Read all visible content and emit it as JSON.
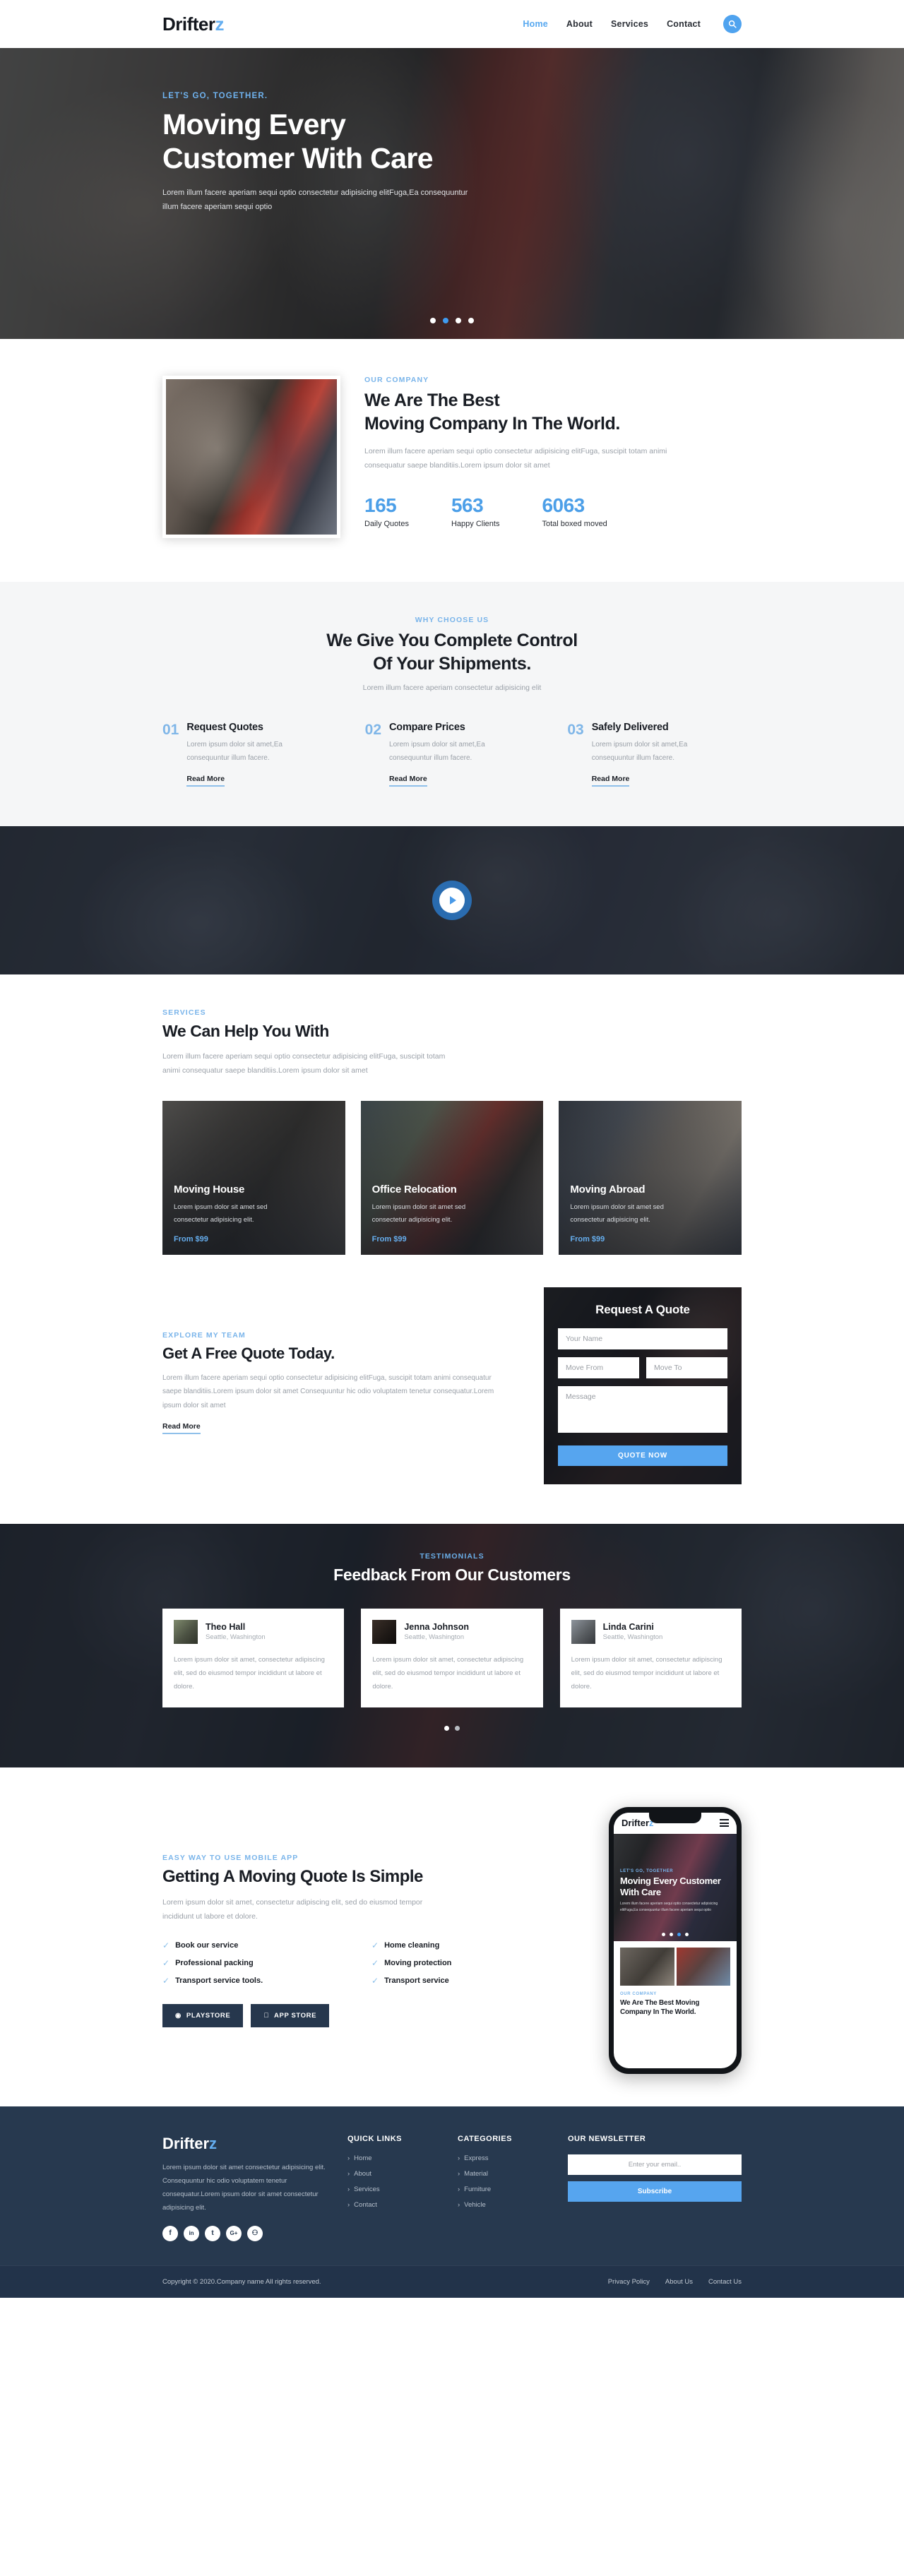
{
  "header": {
    "logo_main": "Drifter",
    "logo_accent": "z",
    "nav": [
      {
        "label": "Home",
        "active": true
      },
      {
        "label": "About",
        "active": false
      },
      {
        "label": "Services",
        "active": false
      },
      {
        "label": "Contact",
        "active": false
      }
    ],
    "search_icon": "search-icon"
  },
  "hero": {
    "kicker": "LET'S GO, TOGETHER.",
    "title_line1": "Moving Every",
    "title_line2": "Customer With Care",
    "paragraph": "Lorem illum facere aperiam sequi optio consectetur adipisicing elitFuga,Ea consequuntur illum facere aperiam sequi optio",
    "slider_dots": 4,
    "active_dot": 1
  },
  "about": {
    "kicker": "OUR COMPANY",
    "title_line1": "We Are The Best",
    "title_line2": "Moving Company In The World.",
    "paragraph": "Lorem illum facere aperiam sequi optio consectetur adipisicing elitFuga, suscipit totam animi consequatur saepe blanditiis.Lorem ipsum dolor sit amet",
    "stats": [
      {
        "number": "165",
        "label": "Daily Quotes"
      },
      {
        "number": "563",
        "label": "Happy Clients"
      },
      {
        "number": "6063",
        "label": "Total boxed moved"
      }
    ]
  },
  "why": {
    "kicker": "WHY CHOOSE US",
    "title_line1": "We Give You Complete Control",
    "title_line2": "Of Your Shipments.",
    "subtitle": "Lorem illum facere aperiam consectetur adipisicing elit",
    "items": [
      {
        "num": "01",
        "title": "Request Quotes",
        "text": "Lorem ipsum dolor sit amet,Ea consequuntur illum facere.",
        "link": "Read More"
      },
      {
        "num": "02",
        "title": "Compare Prices",
        "text": "Lorem ipsum dolor sit amet,Ea consequuntur illum facere.",
        "link": "Read More"
      },
      {
        "num": "03",
        "title": "Safely Delivered",
        "text": "Lorem ipsum dolor sit amet,Ea consequuntur illum facere.",
        "link": "Read More"
      }
    ]
  },
  "video": {
    "play_icon": "play-icon"
  },
  "services": {
    "kicker": "SERVICES",
    "title": "We Can Help You With",
    "paragraph": "Lorem illum facere aperiam sequi optio consectetur adipisicing elitFuga, suscipit totam animi consequatur saepe blanditiis.Lorem ipsum dolor sit amet",
    "cards": [
      {
        "title": "Moving House",
        "text": "Lorem ipsum dolor sit amet sed consectetur adipisicing elit.",
        "price": "From $99"
      },
      {
        "title": "Office Relocation",
        "text": "Lorem ipsum dolor sit amet sed consectetur adipisicing elit.",
        "price": "From $99"
      },
      {
        "title": "Moving Abroad",
        "text": "Lorem ipsum dolor sit amet sed consectetur adipisicing elit.",
        "price": "From $99"
      }
    ]
  },
  "quote": {
    "kicker": "EXPLORE MY TEAM",
    "title": "Get A Free Quote Today.",
    "paragraph": "Lorem illum facere aperiam sequi optio consectetur adipisicing elitFuga, suscipit totam animi consequatur saepe blanditiis.Lorem ipsum dolor sit amet Consequuntur hic odio voluptatem tenetur consequatur.Lorem ipsum dolor sit amet",
    "link": "Read More",
    "form": {
      "title": "Request A Quote",
      "name_placeholder": "Your Name",
      "from_placeholder": "Move From",
      "to_placeholder": "Move To",
      "message_placeholder": "Message",
      "submit_label": "QUOTE NOW"
    }
  },
  "testimonials": {
    "kicker": "TESTIMONIALS",
    "title": "Feedback From Our Customers",
    "cards": [
      {
        "name": "Theo Hall",
        "location": "Seattle, Washington",
        "text": "Lorem ipsum dolor sit amet, consectetur adipiscing elit, sed do eiusmod tempor incididunt ut labore et dolore."
      },
      {
        "name": "Jenna Johnson",
        "location": "Seattle, Washington",
        "text": "Lorem ipsum dolor sit amet, consectetur adipiscing elit, sed do eiusmod tempor incididunt ut labore et dolore."
      },
      {
        "name": "Linda Carini",
        "location": "Seattle, Washington",
        "text": "Lorem ipsum dolor sit amet, consectetur adipiscing elit, sed do eiusmod tempor incididunt ut labore et dolore."
      }
    ],
    "dots": 2
  },
  "app": {
    "kicker": "EASY WAY TO USE MOBILE APP",
    "title": "Getting A Moving Quote Is Simple",
    "paragraph": "Lorem ipsum dolor sit amet, consectetur adipiscing elit, sed do eiusmod tempor incididunt ut labore et dolore.",
    "features": [
      "Book our service",
      "Home cleaning",
      "Professional packing",
      "Moving protection",
      "Transport service tools.",
      "Transport service"
    ],
    "buttons": [
      {
        "label": "PLAYSTORE",
        "icon": "play-store-icon"
      },
      {
        "label": "APP STORE",
        "icon": "apple-icon"
      }
    ],
    "phone": {
      "logo_main": "Drifter",
      "logo_accent": "z",
      "menu_icon": "hamburger-icon",
      "hero_kicker": "LET'S GO, TOGETHER",
      "hero_title": "Moving Every Customer With Care",
      "hero_paragraph": "Lorem illum facere aperiam sequi optio consectetur adipisicing elitFuga,Ea consequuntur illum facere aperiam sequi optio",
      "about_kicker": "OUR COMPANY",
      "about_title": "We Are The Best Moving Company In The World."
    }
  },
  "footer": {
    "logo_main": "Drifter",
    "logo_accent": "z",
    "description": "Lorem ipsum dolor sit amet consectetur adipisicing elit. Consequuntur hic odio voluptatem tenetur consequatur.Lorem ipsum dolor sit amet consectetur adipisicing elit.",
    "socials": [
      {
        "name": "facebook-icon",
        "glyph": "f"
      },
      {
        "name": "linkedin-icon",
        "glyph": "in"
      },
      {
        "name": "twitter-icon",
        "glyph": "t"
      },
      {
        "name": "google-plus-icon",
        "glyph": "G+"
      },
      {
        "name": "github-icon",
        "glyph": "⚇"
      }
    ],
    "quick_links_title": "QUICK LINKS",
    "quick_links": [
      "Home",
      "About",
      "Services",
      "Contact"
    ],
    "categories_title": "CATEGORIES",
    "categories": [
      "Express",
      "Material",
      "Furniture",
      "Vehicle"
    ],
    "newsletter_title": "OUR NEWSLETTER",
    "newsletter_placeholder": "Enter your email..",
    "newsletter_button": "Subscribe",
    "copyright": "Copyright © 2020.Company name All rights reserved.",
    "bottom_links": [
      "Privacy Policy",
      "About Us",
      "Contact Us"
    ]
  },
  "colors": {
    "accent": "#56a5ef",
    "accent_light": "#79b4ea",
    "dark": "#27394f",
    "darker": "#22334a"
  }
}
